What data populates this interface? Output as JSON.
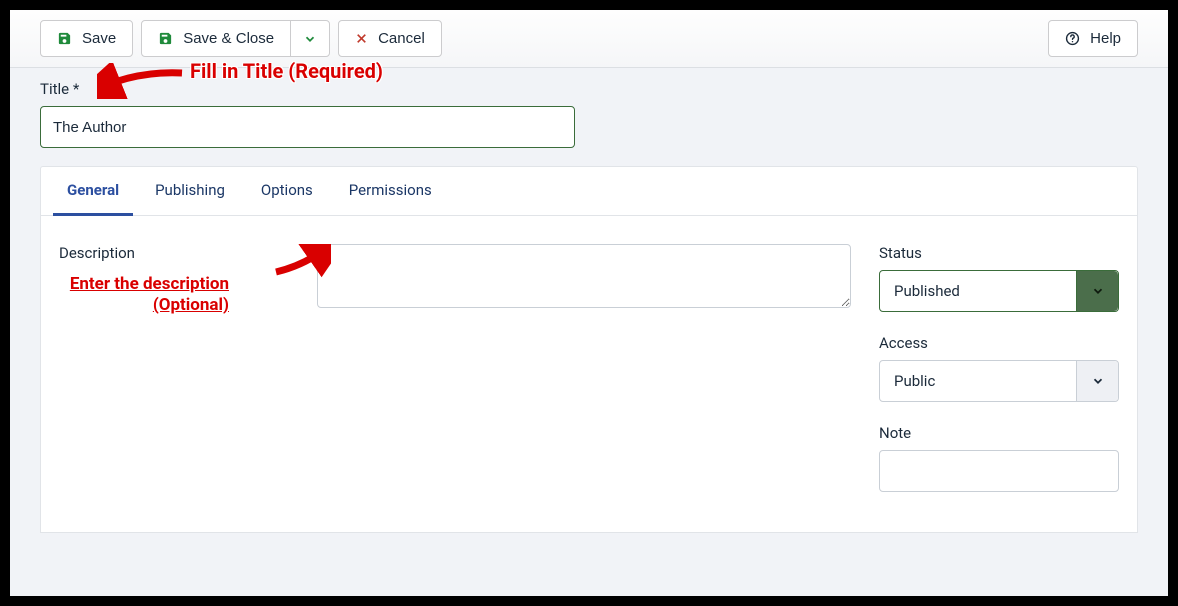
{
  "toolbar": {
    "save": "Save",
    "save_close": "Save & Close",
    "cancel": "Cancel",
    "help": "Help"
  },
  "title": {
    "label": "Title *",
    "value": "The Author"
  },
  "annotations": {
    "title_hint": "Fill in Title (Required)",
    "desc_hint_line1": "Enter the description",
    "desc_hint_line2": "(Optional)"
  },
  "tabs": {
    "general": "General",
    "publishing": "Publishing",
    "options": "Options",
    "permissions": "Permissions"
  },
  "fields": {
    "description_label": "Description",
    "description_value": "",
    "status_label": "Status",
    "status_value": "Published",
    "access_label": "Access",
    "access_value": "Public",
    "note_label": "Note",
    "note_value": ""
  }
}
